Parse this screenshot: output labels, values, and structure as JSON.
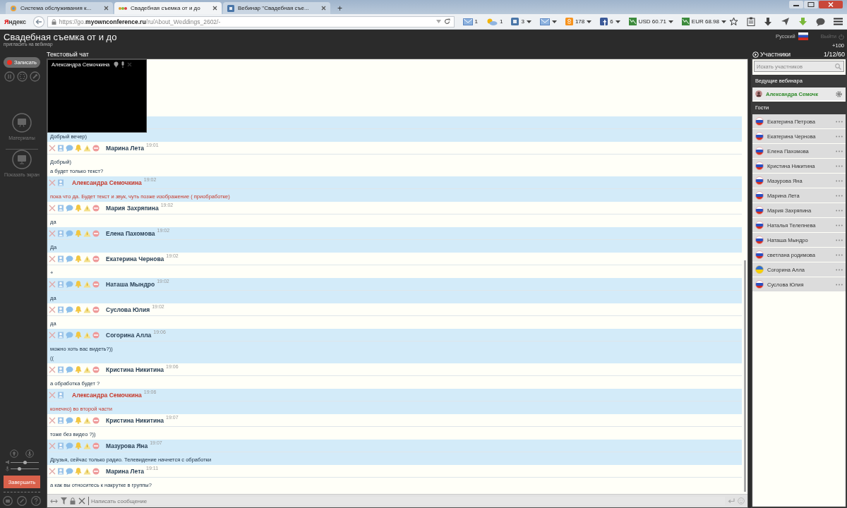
{
  "browser": {
    "tabs": [
      {
        "label": "Система обслуживания к...",
        "selected": false,
        "kind": "site"
      },
      {
        "label": "Свадебная съемка от и до",
        "selected": true,
        "kind": "conference"
      },
      {
        "label": "Вебинар \"Свадебная съе...",
        "selected": false,
        "kind": "vk"
      }
    ],
    "new_tab": "+",
    "logo": "Яндекс",
    "url": "https://go.**myownconference.ru**/ru/About_Weddings_2602/-",
    "toolbar": [
      {
        "kind": "mail",
        "label": "1",
        "dropdown": false
      },
      {
        "kind": "weather",
        "label": "1",
        "dropdown": false
      },
      {
        "kind": "vk",
        "label": "3",
        "dropdown": true
      },
      {
        "kind": "mail",
        "dropdown": true
      },
      {
        "kind": "ok",
        "label": "178",
        "dropdown": true
      },
      {
        "kind": "fb",
        "label": "6",
        "dropdown": true
      },
      {
        "kind": "currency",
        "label": "USD 60.71",
        "dropdown": true
      },
      {
        "kind": "currency",
        "label": "EUR 68.98",
        "dropdown": true
      }
    ],
    "toolbar_icons": [
      {
        "kind": "star"
      },
      {
        "kind": "clipboard"
      },
      {
        "kind": "download"
      },
      {
        "kind": "send"
      },
      {
        "kind": "download-green"
      },
      {
        "kind": "chat"
      },
      {
        "kind": "menu"
      }
    ]
  },
  "header": {
    "title": "Свадебная съемка от и до",
    "invite_link": "пригласить на вебинар",
    "language": "Русский",
    "logout": {
      "label": "Выйти",
      "disabled": true
    },
    "counter": "+100"
  },
  "sidebar": {
    "record_button": "Записать",
    "materials_label": "Материалы",
    "screen_label": "Показать экран",
    "volume": {
      "level": 0.5
    },
    "mic": {
      "level": 0.3
    },
    "finish_button": "Завершить"
  },
  "chat": {
    "label": "Текстовый чат",
    "video": {
      "name": "Александра Семочкина"
    },
    "messages": [
      {
        "kind": "hidden",
        "texts": [
          "Добрый вечер)"
        ]
      },
      {
        "kind": "guest",
        "author": "Марина Лета",
        "time": "19:01",
        "texts": [
          "Добрый)",
          "а будет только текст?"
        ]
      },
      {
        "kind": "host",
        "author": "Александра Семочкина",
        "time": "19:02",
        "texts": [
          "пока что да. Будет текст и звук, чуть позже изображение ( приобработке)"
        ]
      },
      {
        "kind": "guest",
        "author": "Мария Захряпина",
        "time": "19:02",
        "texts": [
          "да"
        ]
      },
      {
        "kind": "guest",
        "author": "Елена Пахомова",
        "time": "19:02",
        "texts": [
          "Да"
        ]
      },
      {
        "kind": "guest",
        "author": "Екатерина Чернова",
        "time": "19:02",
        "texts": [
          "+"
        ]
      },
      {
        "kind": "guest",
        "author": "Наташа Мындро",
        "time": "19:02",
        "texts": [
          "да"
        ]
      },
      {
        "kind": "guest",
        "author": "Суслова Юлия",
        "time": "19:02",
        "texts": [
          "да"
        ]
      },
      {
        "kind": "guest",
        "author": "Согорина Алла",
        "time": "19:06",
        "texts": [
          "можно хоть вас видеть?))",
          "(("
        ]
      },
      {
        "kind": "guest",
        "author": "Кристина Никитина",
        "time": "19:06",
        "texts": [
          "а обработка будет ?"
        ]
      },
      {
        "kind": "host",
        "author": "Александра Семочкина",
        "time": "19:06",
        "texts": [
          "конечно) во второй части"
        ]
      },
      {
        "kind": "guest",
        "author": "Кристина Никитина",
        "time": "19:07",
        "texts": [
          "тоже без видео ?))"
        ]
      },
      {
        "kind": "guest",
        "author": "Мазурова Яна",
        "time": "19:07",
        "texts": [
          "Друзья, сейчас только радио. Телевидение начнется с обработки"
        ]
      },
      {
        "kind": "guest",
        "author": "Марина Лета",
        "time": "19:11",
        "texts": [
          "а как вы относитесь к накрутке в группы?"
        ]
      }
    ],
    "input_placeholder": "Написать сообщение"
  },
  "participants": {
    "label": "Участники",
    "count": "1/12/60",
    "search_placeholder": "Искать участников",
    "hosts_heading": "Ведущие вебинара",
    "hosts": [
      {
        "name": "Александра Семочк"
      }
    ],
    "guests_heading": "Гости",
    "guests": [
      {
        "name": "Екатерина Петрова",
        "kind": "ru"
      },
      {
        "name": "Екатерина Чернова",
        "kind": "ru"
      },
      {
        "name": "Елена Пахомова",
        "kind": "ru"
      },
      {
        "name": "Кристина Никитина",
        "kind": "ru"
      },
      {
        "name": "Мазурова Яна",
        "kind": "ru"
      },
      {
        "name": "Марина Лета",
        "kind": "ru"
      },
      {
        "name": "Мария Захряпина",
        "kind": "ru"
      },
      {
        "name": "Наталья Телепнева",
        "kind": "ru"
      },
      {
        "name": "Наташа Мындро",
        "kind": "ru"
      },
      {
        "name": "светлана родимова",
        "kind": "ru"
      },
      {
        "name": "Согорина Алла",
        "kind": "ua"
      },
      {
        "name": "Суслова Юлия",
        "kind": "ru"
      }
    ]
  }
}
